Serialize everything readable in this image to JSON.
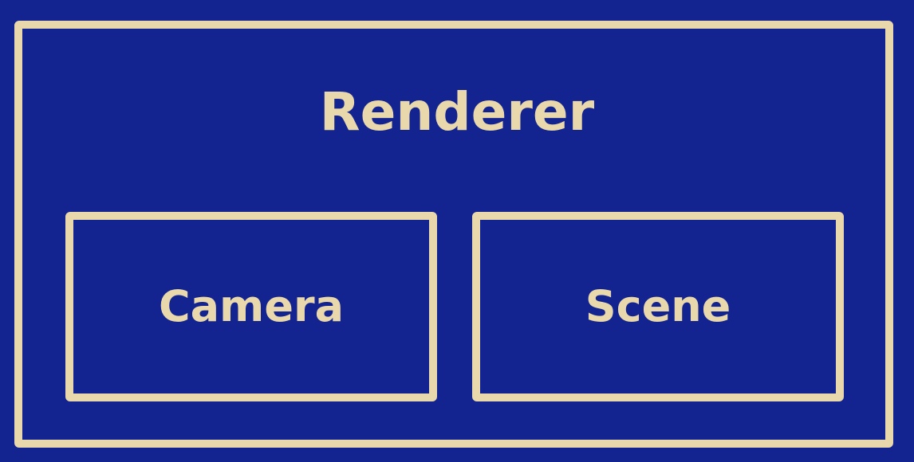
{
  "diagram": {
    "outer_label": "Renderer",
    "children": [
      {
        "label": "Camera"
      },
      {
        "label": "Scene"
      }
    ]
  },
  "colors": {
    "background": "#13238f",
    "stroke": "#ead8ad",
    "text": "#ead8ad"
  }
}
